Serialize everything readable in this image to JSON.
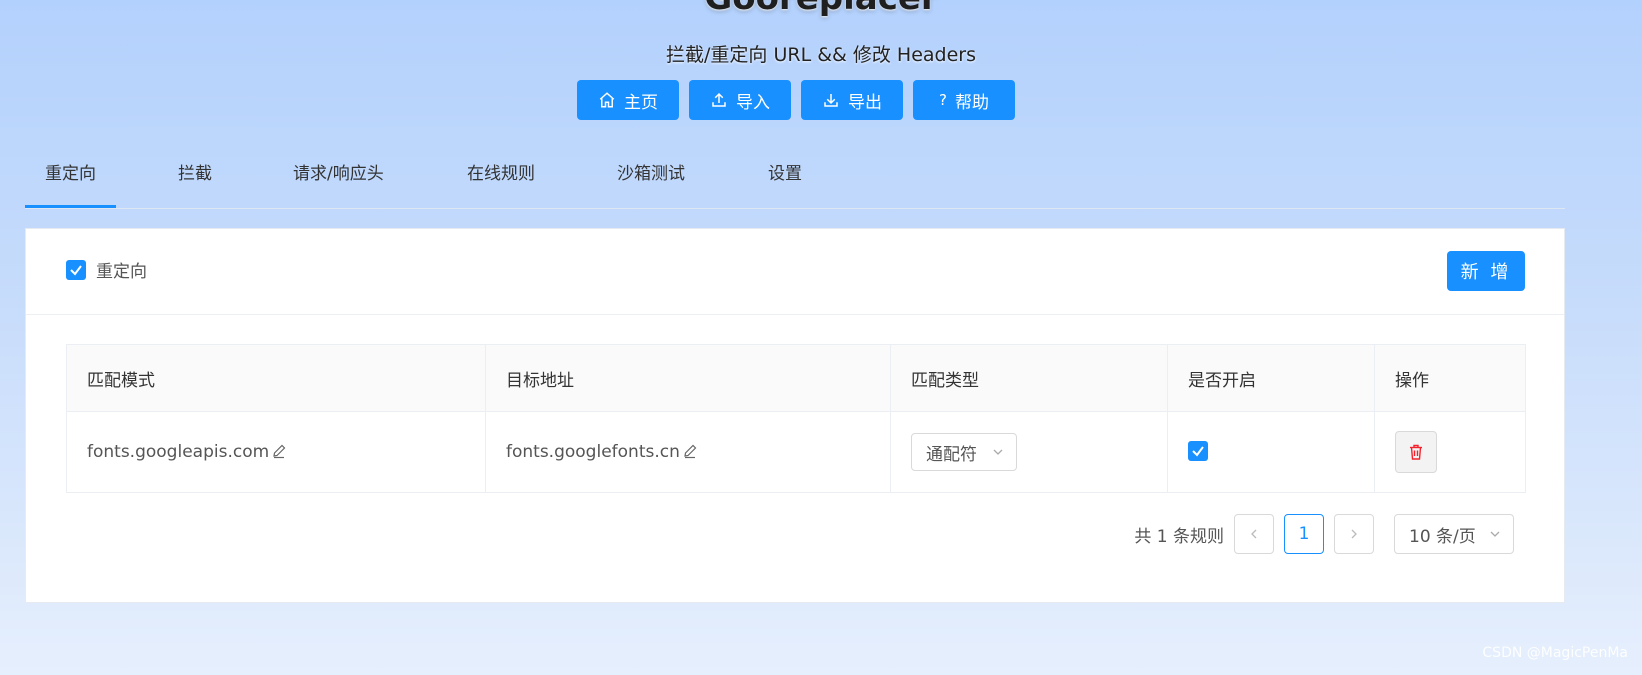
{
  "header": {
    "title": "Gooreplacer",
    "subtitle": "拦截/重定向 URL && 修改 Headers",
    "buttons": [
      {
        "label": "主页",
        "icon": "home-icon"
      },
      {
        "label": "导入",
        "icon": "upload-icon"
      },
      {
        "label": "导出",
        "icon": "download-icon"
      },
      {
        "label": "帮助",
        "icon": "question-icon"
      }
    ]
  },
  "tabs": [
    "重定向",
    "拦截",
    "请求/响应头",
    "在线规则",
    "沙箱测试",
    "设置"
  ],
  "active_tab": "重定向",
  "panel": {
    "enable_label": "重定向",
    "enable_checked": true,
    "add_label": "新 增"
  },
  "table": {
    "columns": [
      "匹配模式",
      "目标地址",
      "匹配类型",
      "是否开启",
      "操作"
    ],
    "rows": [
      {
        "pattern": "fonts.googleapis.com",
        "target": "fonts.googlefonts.cn",
        "match_type": "通配符",
        "enabled": true
      }
    ]
  },
  "pagination": {
    "total_text": "共 1 条规则",
    "current_page": "1",
    "page_size": "10 条/页"
  },
  "watermark": "CSDN @MagicPenMa",
  "colors": {
    "primary": "#1890ff",
    "delete": "#f5222d"
  }
}
